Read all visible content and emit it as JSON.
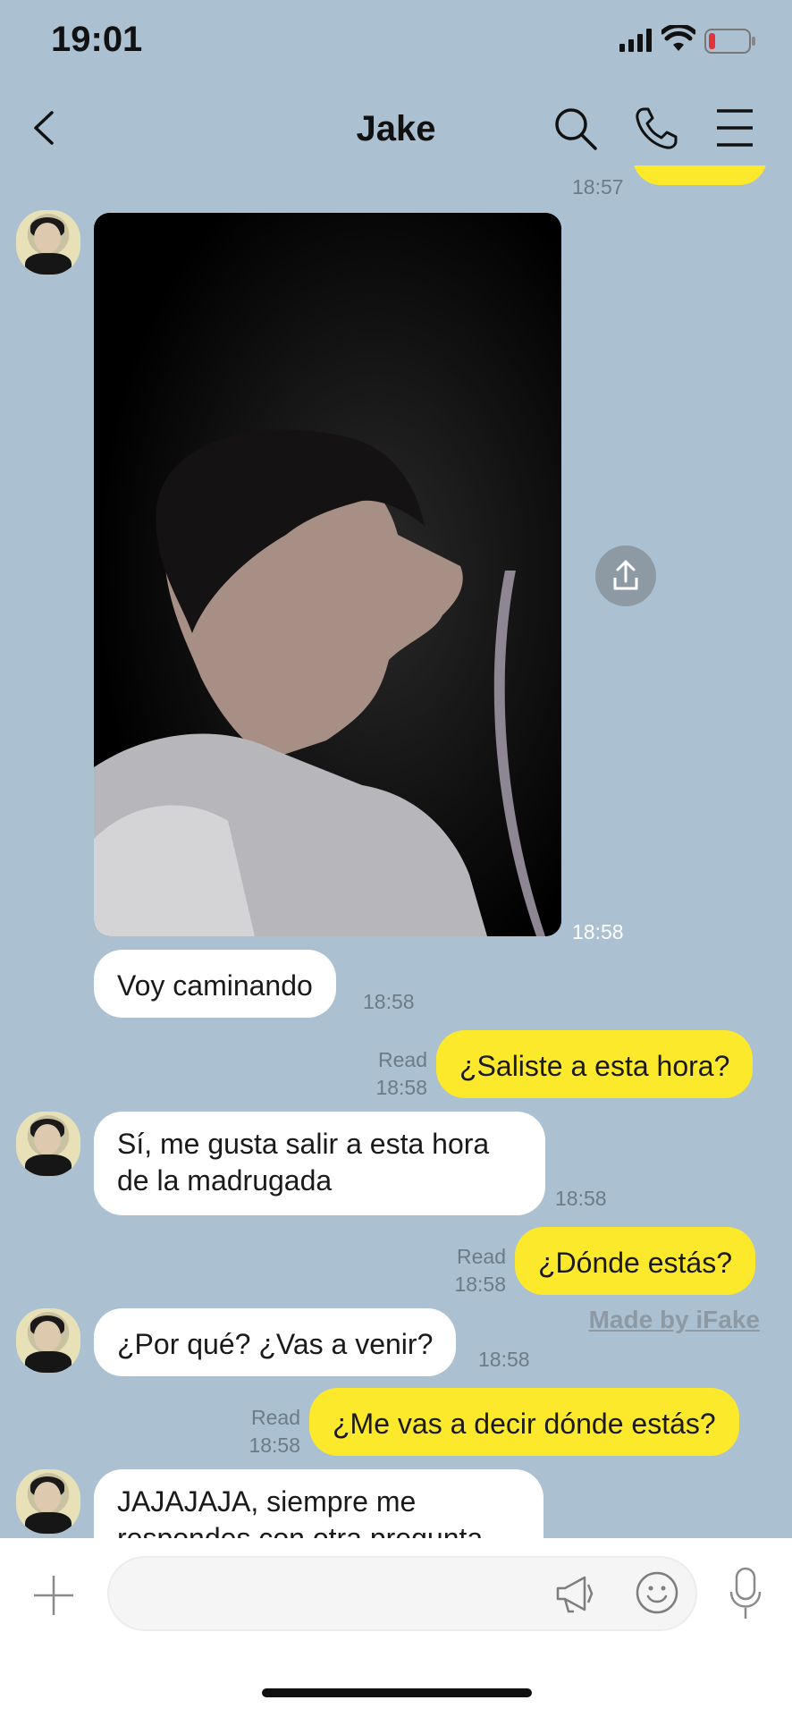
{
  "status_bar": {
    "time": "19:01"
  },
  "header": {
    "title": "Jake"
  },
  "chat": {
    "top_partial_time": "18:57",
    "photo_time": "18:58",
    "messages": [
      {
        "dir": "in",
        "text": "Voy caminando",
        "time": "18:58"
      },
      {
        "dir": "out",
        "text": "¿Saliste a esta hora?",
        "read": "Read",
        "time": "18:58"
      },
      {
        "dir": "in",
        "text": "Sí, me gusta salir a esta hora de la madrugada",
        "line1": "Sí, me gusta salir a esta hora",
        "line2": "de la madrugada",
        "time": "18:58"
      },
      {
        "dir": "out",
        "text": "¿Dónde estás?",
        "read": "Read",
        "time": "18:58"
      },
      {
        "dir": "in",
        "text": "¿Por qué? ¿Vas a venir?",
        "time": "18:58"
      },
      {
        "dir": "out",
        "text": "¿Me vas a decir dónde estás?",
        "read": "Read",
        "time": "18:58"
      },
      {
        "dir": "in",
        "text": "JAJAJAJA, siempre me responde con otra pregunta",
        "line1": "JAJAJAJA, siempre me",
        "line2": "respondes con otra pregunta"
      }
    ]
  },
  "watermark": "Made by iFake",
  "colors": {
    "background": "#abc1d1",
    "outgoing": "#fde92b",
    "incoming": "#ffffff"
  },
  "icons": [
    "back-icon",
    "search-icon",
    "phone-icon",
    "menu-icon",
    "share-icon",
    "plus-icon",
    "megaphone-icon",
    "emoji-icon",
    "microphone-icon"
  ]
}
